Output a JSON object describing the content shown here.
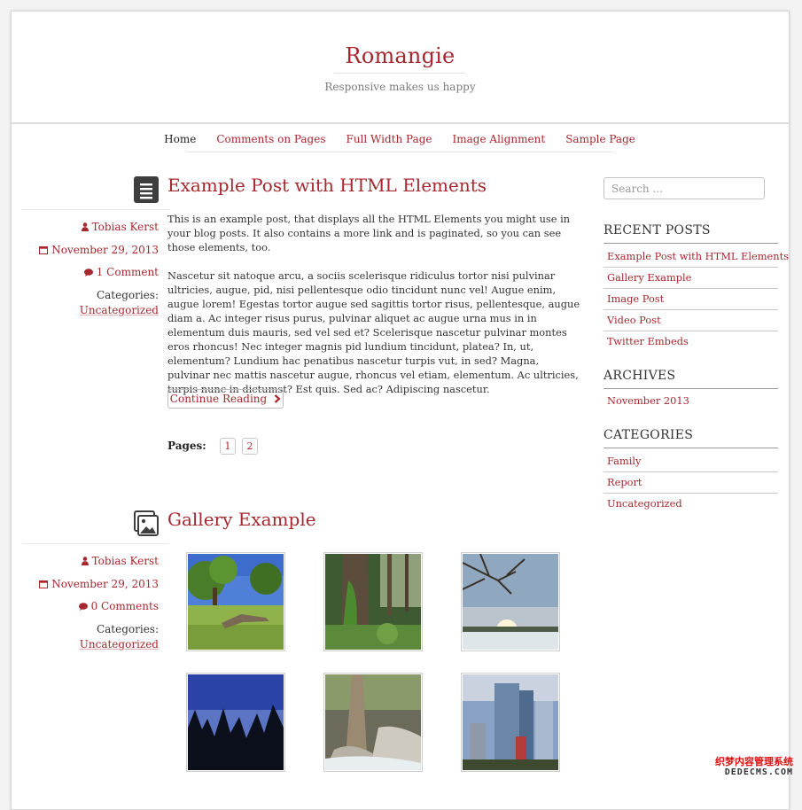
{
  "header": {
    "site_title": "Romangie",
    "tagline": "Responsive makes us happy"
  },
  "nav": {
    "items": [
      "Home",
      "Comments on Pages",
      "Full Width Page",
      "Image Alignment",
      "Sample Page"
    ],
    "current": "Home"
  },
  "posts": [
    {
      "type_icon": "text-lines-icon",
      "title": "Example Post with HTML Elements",
      "author": "Tobias Kerst",
      "date": "November 29, 2013",
      "comments": "1 Comment",
      "categories_label": "Categories:",
      "category": "Uncategorized",
      "paragraphs": [
        "This is an example post, that displays all the HTML Elements you might use in your blog posts. It also contains a more link and is paginated, so you can see those elements, too.",
        "Nascetur sit natoque arcu, a sociis scelerisque ridiculus tortor nisi pulvinar ultricies, augue, pid, nisi pellentesque odio tincidunt nunc vel! Augue enim, augue lorem! Egestas tortor augue sed sagittis tortor risus, pellentesque, augue diam a. Ac integer risus purus, pulvinar aliquet ac augue urna mus in in elementum duis mauris, sed vel sed et? Scelerisque nascetur pulvinar montes eros rhoncus! Nec integer magnis pid lundium tincidunt, platea? In, ut, elementum? Lundium hac penatibus nascetur turpis vut, in sed? Magna, pulvinar nec mattis nascetur augue, rhoncus vel etiam, elementum. Ac ultricies, turpis nunc in dictumst? Est quis. Sed ac? Adipiscing nascetur."
      ],
      "more_label": "Continue Reading",
      "pages_label": "Pages:",
      "pages": [
        "1",
        "2"
      ]
    },
    {
      "type_icon": "gallery-icon",
      "title": "Gallery Example",
      "author": "Tobias Kerst",
      "date": "November 29, 2013",
      "comments": "0 Comments",
      "categories_label": "Categories:",
      "category": "Uncategorized",
      "gallery": [
        "meadow-tree-photo",
        "mossy-tree-photo",
        "bare-branches-sunset-photo",
        "silhouette-trees-photo",
        "rocky-stream-photo",
        "glass-skyscrapers-photo"
      ]
    }
  ],
  "sidebar": {
    "search_placeholder": "Search ...",
    "recent_posts_title": "RECENT POSTS",
    "recent_posts": [
      "Example Post with HTML Elements",
      "Gallery Example",
      "Image Post",
      "Video Post",
      "Twitter Embeds"
    ],
    "archives_title": "ARCHIVES",
    "archives": [
      "November 2013"
    ],
    "categories_title": "CATEGORIES",
    "categories": [
      "Family",
      "Report",
      "Uncategorized"
    ]
  },
  "watermark": {
    "line1": "织梦内容管理系统",
    "line2": "DEDECMS.COM"
  },
  "colors": {
    "accent": "#a6272e",
    "text": "#333333",
    "background": "#f3f3f3"
  }
}
